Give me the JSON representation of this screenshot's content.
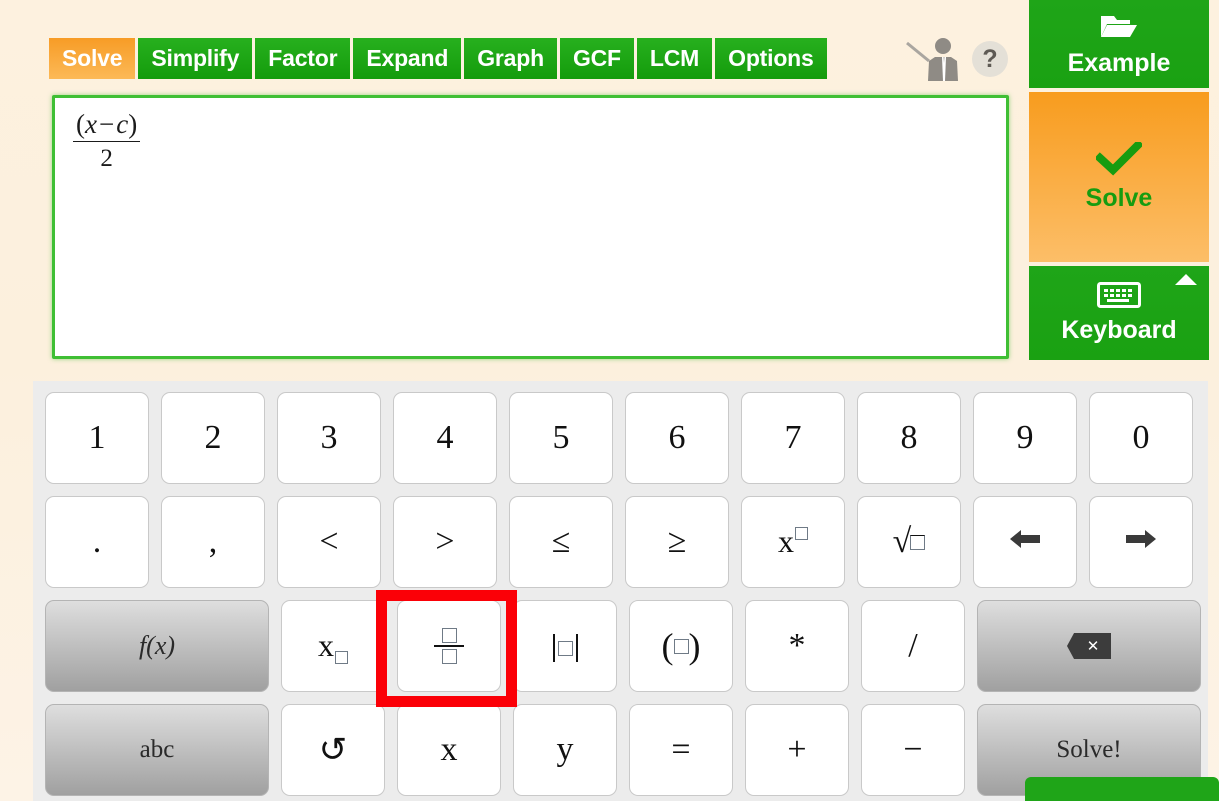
{
  "app": {
    "background_color": "#fdf1df",
    "brand_green": "#1fa518",
    "brand_orange": "#f89c1e",
    "highlight_color": "#fb0007"
  },
  "topbar": {
    "tabs": [
      {
        "label": "Solve",
        "active": true,
        "name": "tab-solve"
      },
      {
        "label": "Simplify",
        "active": false,
        "name": "tab-simplify"
      },
      {
        "label": "Factor",
        "active": false,
        "name": "tab-factor"
      },
      {
        "label": "Expand",
        "active": false,
        "name": "tab-expand"
      },
      {
        "label": "Graph",
        "active": false,
        "name": "tab-graph"
      },
      {
        "label": "GCF",
        "active": false,
        "name": "tab-gcf"
      },
      {
        "label": "LCM",
        "active": false,
        "name": "tab-lcm"
      },
      {
        "label": "Options",
        "active": false,
        "name": "tab-options"
      }
    ],
    "teacher_icon": "teacher-pointer-icon",
    "help_icon": "?"
  },
  "expression": {
    "numerator_open": "(",
    "numerator_var1": "x",
    "numerator_operator": "−",
    "numerator_var2": "c",
    "numerator_close": ")",
    "denominator": "2",
    "plain_text": "(x - c)/2"
  },
  "actions": {
    "example": {
      "label": "Example",
      "icon": "folder-open-icon"
    },
    "solve": {
      "label": "Solve",
      "icon": "check-mark-icon"
    },
    "keyboard": {
      "label": "Keyboard",
      "icon": "keyboard-icon",
      "collapse_icon": "caret-up-icon"
    }
  },
  "keypad": {
    "rows": [
      [
        {
          "label": "1",
          "name": "key-1",
          "type": "text"
        },
        {
          "label": "2",
          "name": "key-2",
          "type": "text"
        },
        {
          "label": "3",
          "name": "key-3",
          "type": "text"
        },
        {
          "label": "4",
          "name": "key-4",
          "type": "text"
        },
        {
          "label": "5",
          "name": "key-5",
          "type": "text"
        },
        {
          "label": "6",
          "name": "key-6",
          "type": "text"
        },
        {
          "label": "7",
          "name": "key-7",
          "type": "text"
        },
        {
          "label": "8",
          "name": "key-8",
          "type": "text"
        },
        {
          "label": "9",
          "name": "key-9",
          "type": "text"
        },
        {
          "label": "0",
          "name": "key-0",
          "type": "text"
        }
      ],
      [
        {
          "label": ".",
          "name": "key-decimal-point",
          "type": "text"
        },
        {
          "label": ",",
          "name": "key-comma",
          "type": "text"
        },
        {
          "label": "<",
          "name": "key-less-than",
          "type": "text"
        },
        {
          "label": ">",
          "name": "key-greater-than",
          "type": "text"
        },
        {
          "label": "≤",
          "name": "key-less-than-or-equal",
          "type": "text"
        },
        {
          "label": "≥",
          "name": "key-greater-than-or-equal",
          "type": "text"
        },
        {
          "label": "x□",
          "name": "key-power",
          "type": "power"
        },
        {
          "label": "√□",
          "name": "key-square-root",
          "type": "sqrt"
        },
        {
          "label": "←",
          "name": "key-arrow-left",
          "type": "arrow-left"
        },
        {
          "label": "→",
          "name": "key-arrow-right",
          "type": "arrow-right"
        }
      ],
      [
        {
          "label": "f(x)",
          "name": "key-functions",
          "type": "fx",
          "style": "grey",
          "wide": true
        },
        {
          "label": "x□",
          "name": "key-subscript",
          "type": "subscript"
        },
        {
          "label": "□/□",
          "name": "key-fraction",
          "type": "fraction",
          "highlighted": true
        },
        {
          "label": "|□|",
          "name": "key-absolute-value",
          "type": "abs"
        },
        {
          "label": "(□)",
          "name": "key-parentheses",
          "type": "paren"
        },
        {
          "label": "*",
          "name": "key-multiply",
          "type": "text"
        },
        {
          "label": "/",
          "name": "key-divide",
          "type": "text"
        },
        {
          "label": "⌫",
          "name": "key-backspace",
          "type": "backspace",
          "style": "grey",
          "wide": true
        }
      ],
      [
        {
          "label": "abc",
          "name": "key-abc",
          "type": "text",
          "style": "grey",
          "wide": true
        },
        {
          "label": "↺",
          "name": "key-undo",
          "type": "text"
        },
        {
          "label": "x",
          "name": "key-variable-x",
          "type": "text"
        },
        {
          "label": "y",
          "name": "key-variable-y",
          "type": "text"
        },
        {
          "label": "=",
          "name": "key-equals",
          "type": "text"
        },
        {
          "label": "+",
          "name": "key-plus",
          "type": "text"
        },
        {
          "label": "−",
          "name": "key-minus",
          "type": "text"
        },
        {
          "label": "Solve!",
          "name": "key-solve",
          "type": "text",
          "style": "grey",
          "wide": true
        }
      ]
    ]
  }
}
